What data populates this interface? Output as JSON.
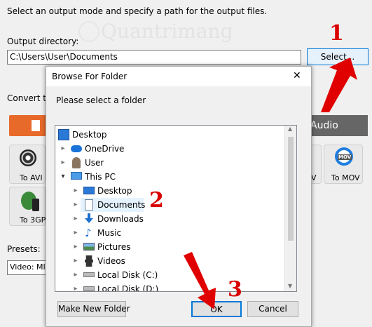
{
  "main": {
    "instruction": "Select an output mode and specify a path for the output files.",
    "output_directory_label": "Output directory:",
    "output_directory_value": "C:\\Users\\User\\Documents",
    "select_button": "Select...",
    "convert_to_label": "Convert to",
    "audio_tab": "Audio",
    "to_avi": "To AVI",
    "to_3gp": "To 3GP",
    "to_mov": "To MOV",
    "partial_v": "V",
    "presets_label": "Presets:",
    "presets_value": "Video: MI"
  },
  "watermark": "Quantrimang",
  "dialog": {
    "title": "Browse For Folder",
    "close_glyph": "✕",
    "prompt": "Please select a folder",
    "tree": [
      {
        "label": "Desktop",
        "icon": "desktop-icon"
      },
      {
        "label": "OneDrive",
        "icon": "cloud-icon"
      },
      {
        "label": "User",
        "icon": "user-icon"
      },
      {
        "label": "This PC",
        "icon": "computer-icon"
      },
      {
        "label": "Desktop",
        "icon": "desktop-icon"
      },
      {
        "label": "Documents",
        "icon": "documents-icon"
      },
      {
        "label": "Downloads",
        "icon": "downloads-icon"
      },
      {
        "label": "Music",
        "icon": "music-icon"
      },
      {
        "label": "Pictures",
        "icon": "pictures-icon"
      },
      {
        "label": "Videos",
        "icon": "videos-icon"
      },
      {
        "label": "Local Disk (C:)",
        "icon": "disk-icon"
      },
      {
        "label": "Local Disk (D:)",
        "icon": "disk-icon"
      }
    ],
    "make_new_folder": "Make New Folder",
    "ok": "OK",
    "cancel": "Cancel"
  },
  "annotations": {
    "step1": "1",
    "step2": "2",
    "step3": "3"
  }
}
